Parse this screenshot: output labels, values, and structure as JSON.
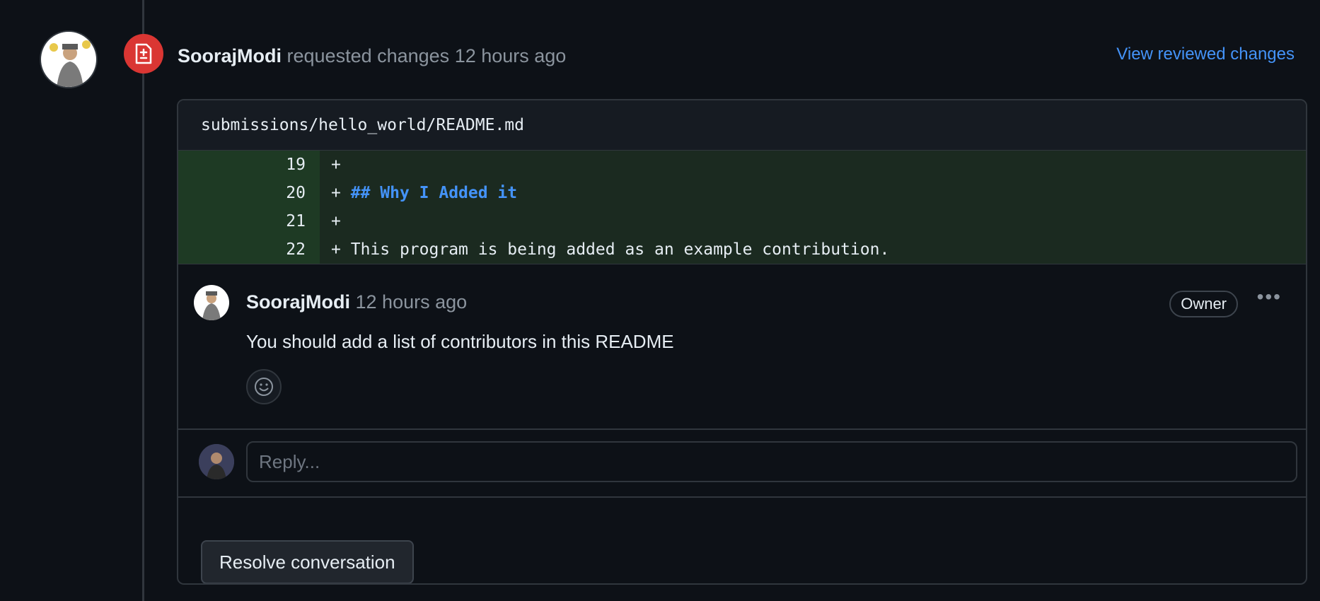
{
  "review": {
    "author": "SoorajModi",
    "action": "requested changes",
    "time": "12 hours ago",
    "view_link": "View reviewed changes",
    "badge_icon": "file-diff-icon",
    "status_color": "#da3633"
  },
  "file": {
    "path": "submissions/hello_world/README.md",
    "lines": [
      {
        "num": "19",
        "prefix": "+",
        "text": "",
        "heading": false
      },
      {
        "num": "20",
        "prefix": "+",
        "text": "## Why I Added it",
        "heading": true
      },
      {
        "num": "21",
        "prefix": "+",
        "text": "",
        "heading": false
      },
      {
        "num": "22",
        "prefix": "+",
        "text": "This program is being added as an example contribution.",
        "heading": false
      }
    ]
  },
  "comment": {
    "author": "SoorajModi",
    "time": "12 hours ago",
    "role": "Owner",
    "more_icon": "kebab-horizontal-icon",
    "body": "You should add a list of contributors in this README",
    "reaction_icon": "smiley-icon"
  },
  "reply": {
    "placeholder": "Reply..."
  },
  "resolve": {
    "label": "Resolve conversation"
  },
  "colors": {
    "link": "#4493f8",
    "added_line_bg": "#1b2a20",
    "added_num_bg": "#1e3a24"
  }
}
